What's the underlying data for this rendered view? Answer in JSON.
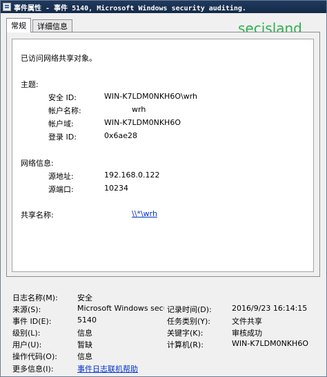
{
  "window": {
    "title": "事件属性 - 事件 5140, Microsoft Windows security auditing."
  },
  "tabs": [
    {
      "label": "常规"
    },
    {
      "label": "详细信息"
    }
  ],
  "watermark": "secisland",
  "description": {
    "intro": "已访问网络共享对象。",
    "subject_header": "主题:",
    "subject": {
      "security_id_label": "安全 ID:",
      "security_id_value": "WIN-K7LDM0NKH6O\\wrh",
      "account_name_label": "帐户名称:",
      "account_name_value": "wrh",
      "account_domain_label": "帐户域:",
      "account_domain_value": "WIN-K7LDM0NKH6O",
      "logon_id_label": "登录 ID:",
      "logon_id_value": "0x6ae28"
    },
    "network_header": "网络信息:",
    "network": {
      "src_addr_label": "源地址:",
      "src_addr_value": "192.168.0.122",
      "src_port_label": "源端口:",
      "src_port_value": "10234"
    },
    "share_name_label": "共享名称:",
    "share_name_value": "\\\\*\\wrh"
  },
  "details": {
    "log_name_label": "日志名称(M):",
    "log_name_value": "安全",
    "source_label": "来源(S):",
    "source_value": "Microsoft Windows secur",
    "logged_label": "记录时间(D):",
    "logged_value": "2016/9/23 16:14:15",
    "event_id_label": "事件 ID(E):",
    "event_id_value": "5140",
    "task_category_label": "任务类别(Y):",
    "task_category_value": "文件共享",
    "level_label": "级别(L):",
    "level_value": "信息",
    "keywords_label": "关键字(K):",
    "keywords_value": "审核成功",
    "user_label": "用户(U):",
    "user_value": "暂缺",
    "computer_label": "计算机(R):",
    "computer_value": "WIN-K7LDM0NKH6O",
    "opcode_label": "操作代码(O):",
    "opcode_value": "信息",
    "more_info_label": "更多信息(I):",
    "more_info_link": "事件日志联机帮助"
  }
}
